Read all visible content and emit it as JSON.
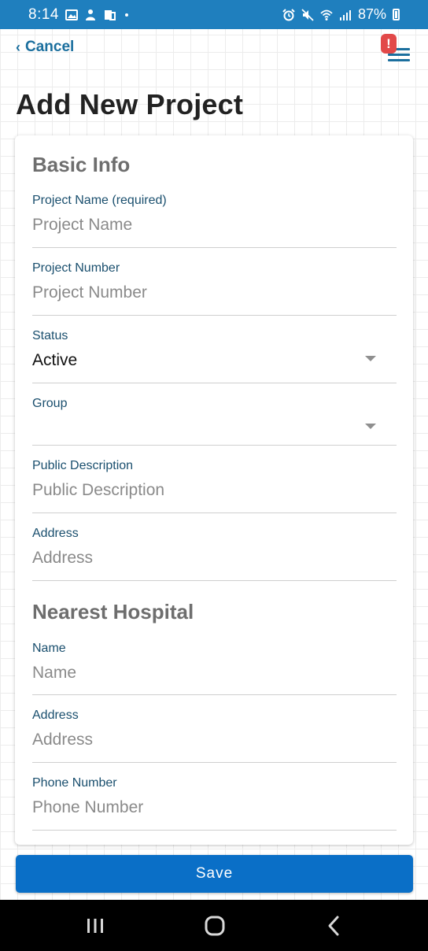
{
  "status_bar": {
    "time": "8:14",
    "battery_text": "87%",
    "background": "#1f7fbe",
    "left_icons": [
      "image-icon",
      "person-icon",
      "app-icon"
    ],
    "right_icons": [
      "alarm-icon",
      "mute-icon",
      "wifi-icon",
      "signal-icon",
      "battery-icon"
    ]
  },
  "nav": {
    "cancel_label": "Cancel",
    "alert_badge": "!",
    "menu_icon": "hamburger-menu-icon",
    "accent_color": "#1b6f9e"
  },
  "page": {
    "title": "Add New Project"
  },
  "form": {
    "basic_info_title": "Basic Info",
    "project_name": {
      "label": "Project Name (required)",
      "placeholder": "Project Name",
      "value": ""
    },
    "project_number": {
      "label": "Project Number",
      "placeholder": "Project Number",
      "value": ""
    },
    "status": {
      "label": "Status",
      "value": "Active"
    },
    "group": {
      "label": "Group",
      "value": ""
    },
    "public_description": {
      "label": "Public Description",
      "placeholder": "Public Description",
      "value": ""
    },
    "address": {
      "label": "Address",
      "placeholder": "Address",
      "value": ""
    },
    "nearest_hospital_title": "Nearest Hospital",
    "hospital_name": {
      "label": "Name",
      "placeholder": "Name",
      "value": ""
    },
    "hospital_address": {
      "label": "Address",
      "placeholder": "Address",
      "value": ""
    },
    "hospital_phone": {
      "label": "Phone Number",
      "placeholder": "Phone Number",
      "value": ""
    }
  },
  "actions": {
    "save_label": "Save",
    "save_color": "#0a6fc7"
  },
  "system_nav": {
    "icons": [
      "recents-icon",
      "home-icon",
      "back-icon"
    ]
  }
}
